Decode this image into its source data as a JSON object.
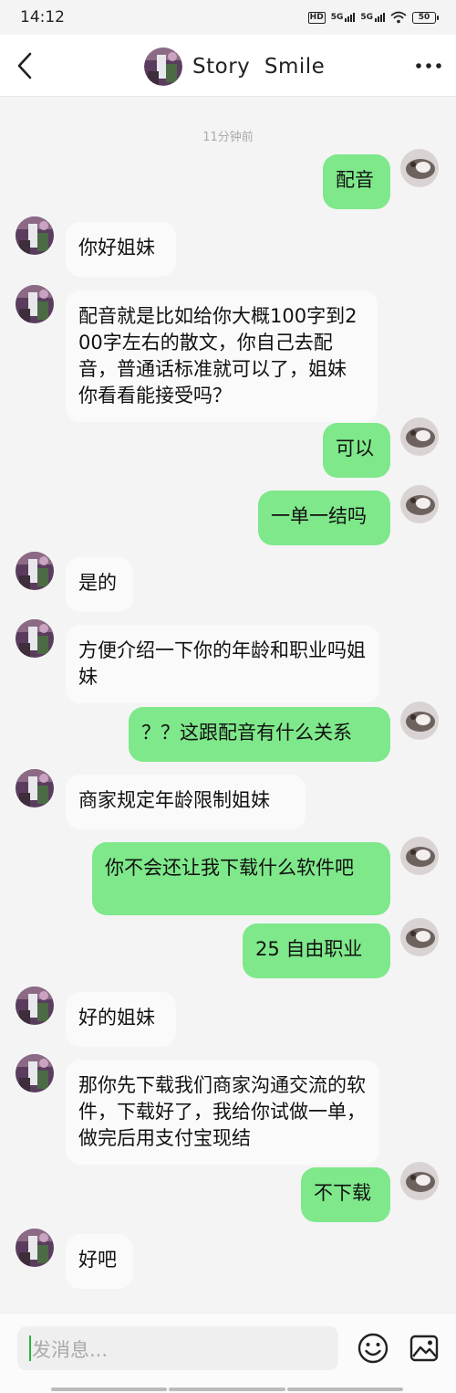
{
  "status_bar": {
    "time": "14:12",
    "network_labels": [
      "HD",
      "5G",
      "5G"
    ],
    "battery": "50"
  },
  "header": {
    "title": "Story  Smile",
    "back_icon": "chevron-left-icon",
    "more_icon": "more-dots-icon"
  },
  "timestamp": "11分钟前",
  "messages": [
    {
      "side": "out",
      "text": "配音"
    },
    {
      "side": "in",
      "text": "你好姐妹"
    },
    {
      "side": "in",
      "text": "配音就是比如给你大概100字到200字左右的散文，你自己去配音，普通话标准就可以了，姐妹你看看能接受吗？"
    },
    {
      "side": "out",
      "text": "可以"
    },
    {
      "side": "out",
      "text": "一单一结吗"
    },
    {
      "side": "in",
      "text": "是的"
    },
    {
      "side": "in",
      "text": "方便介绍一下你的年龄和职业吗姐妹"
    },
    {
      "side": "out",
      "text": "？？这跟配音有什么关系"
    },
    {
      "side": "in",
      "text": "商家规定年龄限制姐妹"
    },
    {
      "side": "out",
      "text": "你不会还让我下载什么软件吧"
    },
    {
      "side": "out",
      "text": "25  自由职业"
    },
    {
      "side": "in",
      "text": "好的姐妹"
    },
    {
      "side": "in",
      "text": "那你先下载我们商家沟通交流的软件，下载好了，我给你试做一单，做完后用支付宝现结"
    },
    {
      "side": "out",
      "text": "不下载"
    },
    {
      "side": "in",
      "text": "好吧"
    }
  ],
  "composer": {
    "placeholder": "发消息...",
    "emoji_icon": "emoji-icon",
    "image_icon": "image-icon"
  },
  "colors": {
    "outgoing_bubble": "#7ee88a",
    "incoming_bubble": "#fafafa",
    "caret": "#27b53b"
  }
}
